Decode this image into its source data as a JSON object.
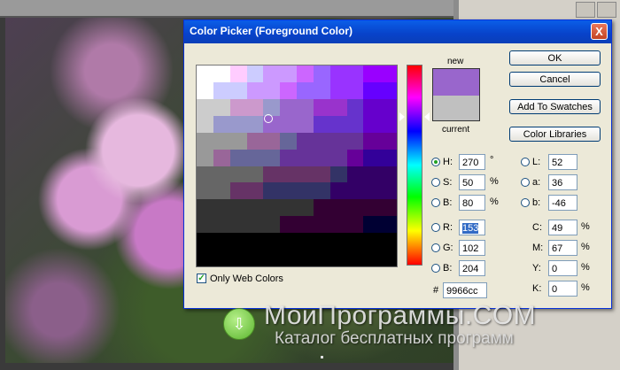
{
  "dialog": {
    "title": "Color Picker (Foreground Color)",
    "close_label": "X",
    "new_label": "new",
    "current_label": "current",
    "new_color": "#9966cc",
    "current_color": "#c0c0c0",
    "buttons": {
      "ok": "OK",
      "cancel": "Cancel",
      "add_to_swatches": "Add To Swatches",
      "color_libraries": "Color Libraries"
    },
    "hsb": [
      {
        "label": "H:",
        "value": "270",
        "unit": "°",
        "selected": true
      },
      {
        "label": "S:",
        "value": "50",
        "unit": "%",
        "selected": false
      },
      {
        "label": "B:",
        "value": "80",
        "unit": "%",
        "selected": false
      }
    ],
    "rgb": [
      {
        "label": "R:",
        "value": "153",
        "selected": false
      },
      {
        "label": "G:",
        "value": "102",
        "selected": false
      },
      {
        "label": "B:",
        "value": "204",
        "selected": false
      }
    ],
    "lab": [
      {
        "label": "L:",
        "value": "52"
      },
      {
        "label": "a:",
        "value": "36"
      },
      {
        "label": "b:",
        "value": "-46"
      }
    ],
    "cmyk": [
      {
        "label": "C:",
        "value": "49",
        "unit": "%"
      },
      {
        "label": "M:",
        "value": "67",
        "unit": "%"
      },
      {
        "label": "Y:",
        "value": "0",
        "unit": "%"
      },
      {
        "label": "K:",
        "value": "0",
        "unit": "%"
      }
    ],
    "hex_label": "#",
    "hex_value": "9966cc",
    "only_web_colors_label": "Only Web Colors",
    "only_web_colors_checked": true
  },
  "watermark": {
    "title": "МоиПрограммы.COM",
    "subtitle": "Каталог бесплатных программ"
  }
}
